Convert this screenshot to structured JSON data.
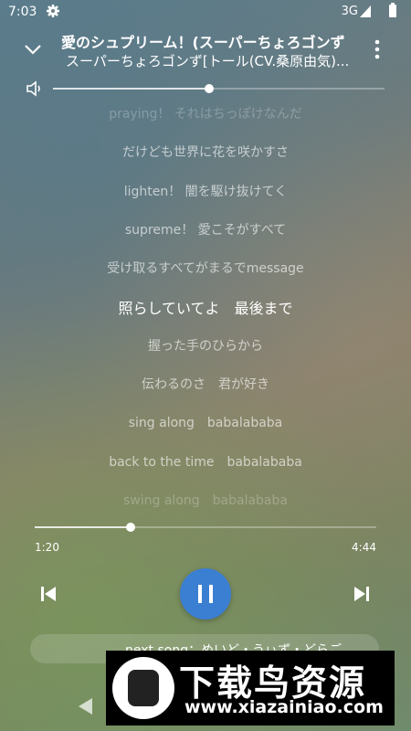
{
  "status_bar": {
    "time": "7:03",
    "network": "3G"
  },
  "now_playing": {
    "title": "愛のシュプリーム！(スーパーちょろゴンず",
    "artist": "スーパーちょろゴンず[トール(CV.桑原由気)..."
  },
  "volume": {
    "level": 0.47
  },
  "lyrics": {
    "current_index": 5,
    "lines": [
      "praying！ それはちっぽけなんだ",
      "だけども世界に花を咲かすさ",
      "lighten！ 闇を駆け抜けてく",
      "supreme！ 愛こそがすべて",
      "受け取るすべてがまるでmessage",
      "照らしていてよ　最後まで",
      "握った手のひらから",
      "伝わるのさ　君が好き",
      "sing along　babalababa",
      "back to the time　babalababa",
      "swing along　babalababa"
    ]
  },
  "progress": {
    "current": "1:20",
    "total": "4:44",
    "fraction": 0.28
  },
  "controls": {
    "state": "playing"
  },
  "next_song": {
    "label": "next song：めいど・うぃず・どらご"
  },
  "watermark": {
    "name": "下载鸟资源",
    "url": "www.xiazainiao.com"
  },
  "colors": {
    "accent": "#3b7fd3"
  }
}
